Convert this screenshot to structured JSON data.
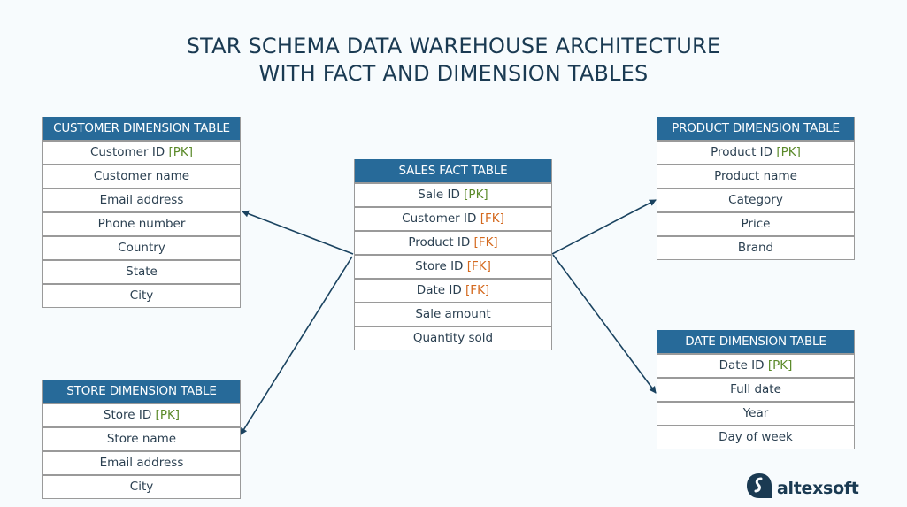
{
  "title": {
    "line1": "STAR SCHEMA DATA WAREHOUSE ARCHITECTURE",
    "line2": "WITH FACT AND DIMENSION TABLES"
  },
  "colors": {
    "header_bg": "#276a99",
    "pk": "#5b8a2a",
    "fk": "#d4691e",
    "arrow": "#1a4360",
    "title": "#1a3a52"
  },
  "tables": {
    "customer": {
      "title": "CUSTOMER DIMENSION TABLE",
      "rows": [
        {
          "text": "Customer ID ",
          "key": "[PK]",
          "key_type": "pk"
        },
        {
          "text": "Customer name"
        },
        {
          "text": "Email address"
        },
        {
          "text": "Phone number"
        },
        {
          "text": "Country"
        },
        {
          "text": "State"
        },
        {
          "text": "City"
        }
      ]
    },
    "sales": {
      "title": "SALES FACT TABLE",
      "rows": [
        {
          "text": "Sale ID ",
          "key": "[PK]",
          "key_type": "pk"
        },
        {
          "text": "Customer ID ",
          "key": "[FK]",
          "key_type": "fk"
        },
        {
          "text": "Product ID ",
          "key": "[FK]",
          "key_type": "fk"
        },
        {
          "text": "Store ID ",
          "key": "[FK]",
          "key_type": "fk"
        },
        {
          "text": "Date ID ",
          "key": "[FK]",
          "key_type": "fk"
        },
        {
          "text": "Sale amount"
        },
        {
          "text": "Quantity sold"
        }
      ]
    },
    "product": {
      "title": "PRODUCT DIMENSION TABLE",
      "rows": [
        {
          "text": "Product ID ",
          "key": "[PK]",
          "key_type": "pk"
        },
        {
          "text": "Product name"
        },
        {
          "text": "Category"
        },
        {
          "text": "Price"
        },
        {
          "text": "Brand"
        }
      ]
    },
    "store": {
      "title": "STORE DIMENSION TABLE",
      "rows": [
        {
          "text": "Store ID ",
          "key": "[PK]",
          "key_type": "pk"
        },
        {
          "text": "Store name"
        },
        {
          "text": "Email address"
        },
        {
          "text": "City"
        }
      ]
    },
    "date": {
      "title": "DATE DIMENSION TABLE",
      "rows": [
        {
          "text": "Date ID ",
          "key": "[PK]",
          "key_type": "pk"
        },
        {
          "text": "Full date"
        },
        {
          "text": "Year"
        },
        {
          "text": "Day of week"
        }
      ]
    }
  },
  "relationships": [
    {
      "from": "sales",
      "to": "customer"
    },
    {
      "from": "sales",
      "to": "store"
    },
    {
      "from": "sales",
      "to": "product"
    },
    {
      "from": "sales",
      "to": "date"
    }
  ],
  "logo": {
    "text": "altexsoft",
    "icon": "altexsoft-logo-icon"
  }
}
